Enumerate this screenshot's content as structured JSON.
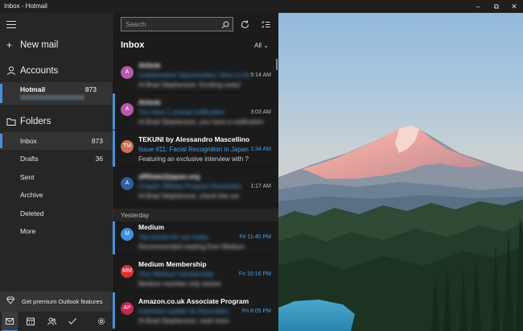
{
  "window": {
    "title": "Inbox - Hotmail"
  },
  "nav": {
    "new_mail": "New mail",
    "accounts_label": "Accounts",
    "account": {
      "name": "Hotmail",
      "count": "873"
    },
    "folders_label": "Folders",
    "folders": [
      {
        "name": "Inbox",
        "count": "873"
      },
      {
        "name": "Drafts",
        "count": "36"
      },
      {
        "name": "Sent",
        "count": ""
      },
      {
        "name": "Archive",
        "count": ""
      },
      {
        "name": "Deleted",
        "count": ""
      },
      {
        "name": "More",
        "count": ""
      }
    ],
    "premium": "Get premium Outlook features"
  },
  "list": {
    "search_placeholder": "Search",
    "title": "Inbox",
    "filter": "All",
    "group_yesterday": "Yesterday",
    "messages": [
      {
        "initials": "A",
        "color": "#b65aa9",
        "sender": "Airbnb",
        "subject": "Collaborative Opportunities: New on Airbnb",
        "preview": "Hi Brad Stephenson. Exciting news!",
        "time": "5:14 AM",
        "blurred": true,
        "unread": false
      },
      {
        "initials": "A",
        "color": "#b65aa9",
        "sender": "Airbnb",
        "subject": "You have 1 unread notification",
        "preview": "Hi Brad Stephenson, you have a notification",
        "time": "3:03 AM",
        "blurred": true,
        "unread": true
      },
      {
        "initials": "TM",
        "color": "#c96f58",
        "sender": "TEKUNI by Alessandro Mascellino",
        "subject": "Issue #11: Facial Recognition in Japan",
        "preview": "Featuring an exclusive interview with ?",
        "time": "1:34 AM",
        "blurred": false,
        "unread": true
      },
      {
        "initials": "A",
        "color": "#2f5f9e",
        "sender": "affiliate@japan.org",
        "subject": "Crispier Affiliate Program Newsletter",
        "preview": "Hi Brad Stephenson, check this out",
        "time": "1:17 AM",
        "blurred": true,
        "unread": false
      },
      {
        "initials": "M",
        "color": "#3d8fe0",
        "sender": "Medium",
        "subject": "Top stories for you today",
        "preview": "Recommended reading from Medium",
        "time": "Fri 11:40 PM",
        "blurred": true,
        "unread": true
      },
      {
        "initials": "MM",
        "color": "#d63333",
        "sender": "Medium Membership",
        "subject": "Your Medium membership",
        "preview": "Medium member only stories",
        "time": "Fri 10:16 PM",
        "blurred": true,
        "unread": false
      },
      {
        "initials": "AP",
        "color": "#c0294f",
        "sender": "Amazon.co.uk Associate Program",
        "subject": "Important update for Associates",
        "preview": "Hi Brad Stephenson, read more",
        "time": "Fri 8:05 PM",
        "blurred": true,
        "unread": true
      }
    ]
  },
  "colors": {
    "accent": "#4a90d9",
    "link": "#4a9fe3"
  }
}
